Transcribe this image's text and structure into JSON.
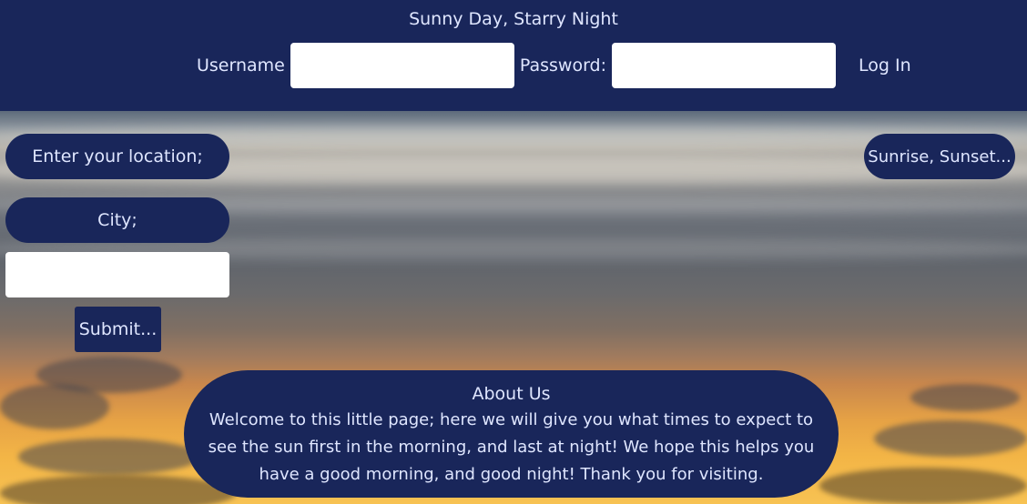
{
  "header": {
    "title": "Sunny Day, Starry Night",
    "username_label": "Username",
    "username_value": "",
    "password_label": "Password:",
    "password_value": "",
    "login_label": "Log In"
  },
  "location": {
    "prompt": "Enter your location;",
    "city_label": "City;",
    "city_value": "",
    "submit_label": "Submit..."
  },
  "sunrise_button": "Sunrise, Sunset...",
  "about": {
    "title": "About Us",
    "text": "Welcome to this little page; here we will give you what times to expect to see the sun first in the morning, and last at night! We hope this helps you have a good morning, and good night! Thank you for visiting."
  },
  "colors": {
    "header_bg": "#19265a",
    "text": "#dfe6ff",
    "input_bg": "#ffffff"
  }
}
